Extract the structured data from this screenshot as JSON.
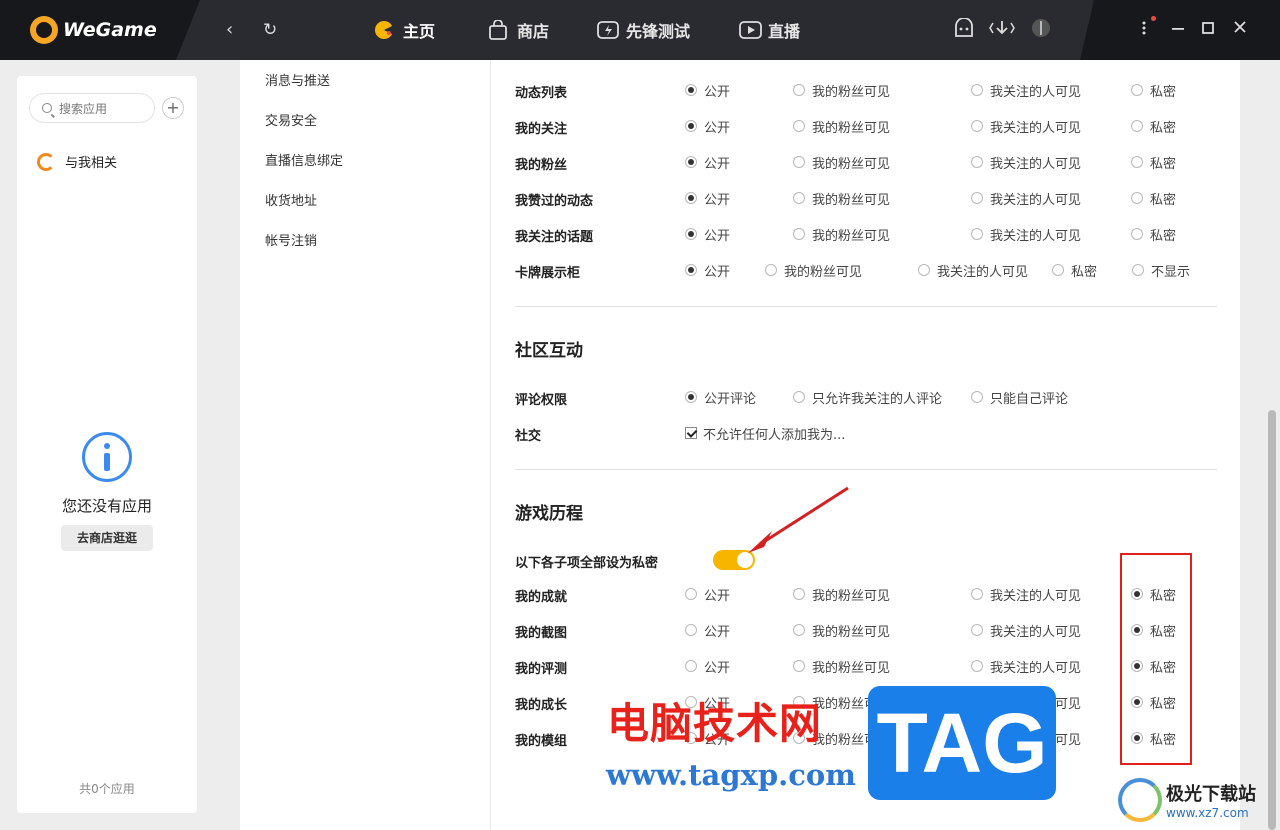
{
  "app": {
    "name": "WeGame"
  },
  "nav": {
    "tabs": [
      "主页",
      "商店",
      "先锋测试",
      "直播"
    ]
  },
  "sidebar": {
    "search_placeholder": "搜索应用",
    "add": "+",
    "related": "与我相关",
    "empty_text": "您还没有应用",
    "store_button": "去商店逛逛",
    "count": "共0个应用"
  },
  "menu": {
    "items": [
      "消息与推送",
      "交易安全",
      "直播信息绑定",
      "收货地址",
      "帐号注销"
    ]
  },
  "privacy_rows": [
    {
      "label": "动态列表",
      "options": [
        "公开",
        "我的粉丝可见",
        "我关注的人可见",
        "私密"
      ],
      "selected": 0
    },
    {
      "label": "我的关注",
      "options": [
        "公开",
        "我的粉丝可见",
        "我关注的人可见",
        "私密"
      ],
      "selected": 0
    },
    {
      "label": "我的粉丝",
      "options": [
        "公开",
        "我的粉丝可见",
        "我关注的人可见",
        "私密"
      ],
      "selected": 0
    },
    {
      "label": "我赞过的动态",
      "options": [
        "公开",
        "我的粉丝可见",
        "我关注的人可见",
        "私密"
      ],
      "selected": 0
    },
    {
      "label": "我关注的话题",
      "options": [
        "公开",
        "我的粉丝可见",
        "我关注的人可见",
        "私密"
      ],
      "selected": 0
    },
    {
      "label": "卡牌展示柜",
      "options": [
        "公开",
        "我的粉丝可见",
        "我关注的人可见",
        "私密",
        "不显示"
      ],
      "selected": 0
    }
  ],
  "community": {
    "title": "社区互动",
    "comment": {
      "label": "评论权限",
      "options": [
        "公开评论",
        "只允许我关注的人评论",
        "只能自己评论"
      ],
      "selected": 0
    },
    "social": {
      "label": "社交",
      "checkbox": "不允许任何人添加我为..."
    }
  },
  "history": {
    "title": "游戏历程",
    "toggle_label": "以下各子项全部设为私密",
    "toggle_on": true,
    "rows": [
      {
        "label": "我的成就",
        "options": [
          "公开",
          "我的粉丝可见",
          "我关注的人可见",
          "私密"
        ],
        "selected": 3
      },
      {
        "label": "我的截图",
        "options": [
          "公开",
          "我的粉丝可见",
          "我关注的人可见",
          "私密"
        ],
        "selected": 3
      },
      {
        "label": "我的评测",
        "options": [
          "公开",
          "我的粉丝可见",
          "我关注的人可见",
          "私密"
        ],
        "selected": 3
      },
      {
        "label": "我的成长",
        "options": [
          "公开",
          "我的粉丝可见",
          "我关注的人可见",
          "私密"
        ],
        "selected": 3
      },
      {
        "label": "我的模组",
        "options": [
          "公开",
          "我的粉丝可见",
          "我关注的人可见",
          "私密"
        ],
        "selected": 3
      }
    ]
  },
  "watermark": {
    "cn": "电脑技术网",
    "url": "www.tagxp.com",
    "tag": "TAG",
    "site_name": "极光下载站",
    "site_url": "www.xz7.com"
  },
  "colors": {
    "accent_toggle": "#f7b500",
    "highlight_box": "#e0201c",
    "arrow": "#d42020"
  }
}
